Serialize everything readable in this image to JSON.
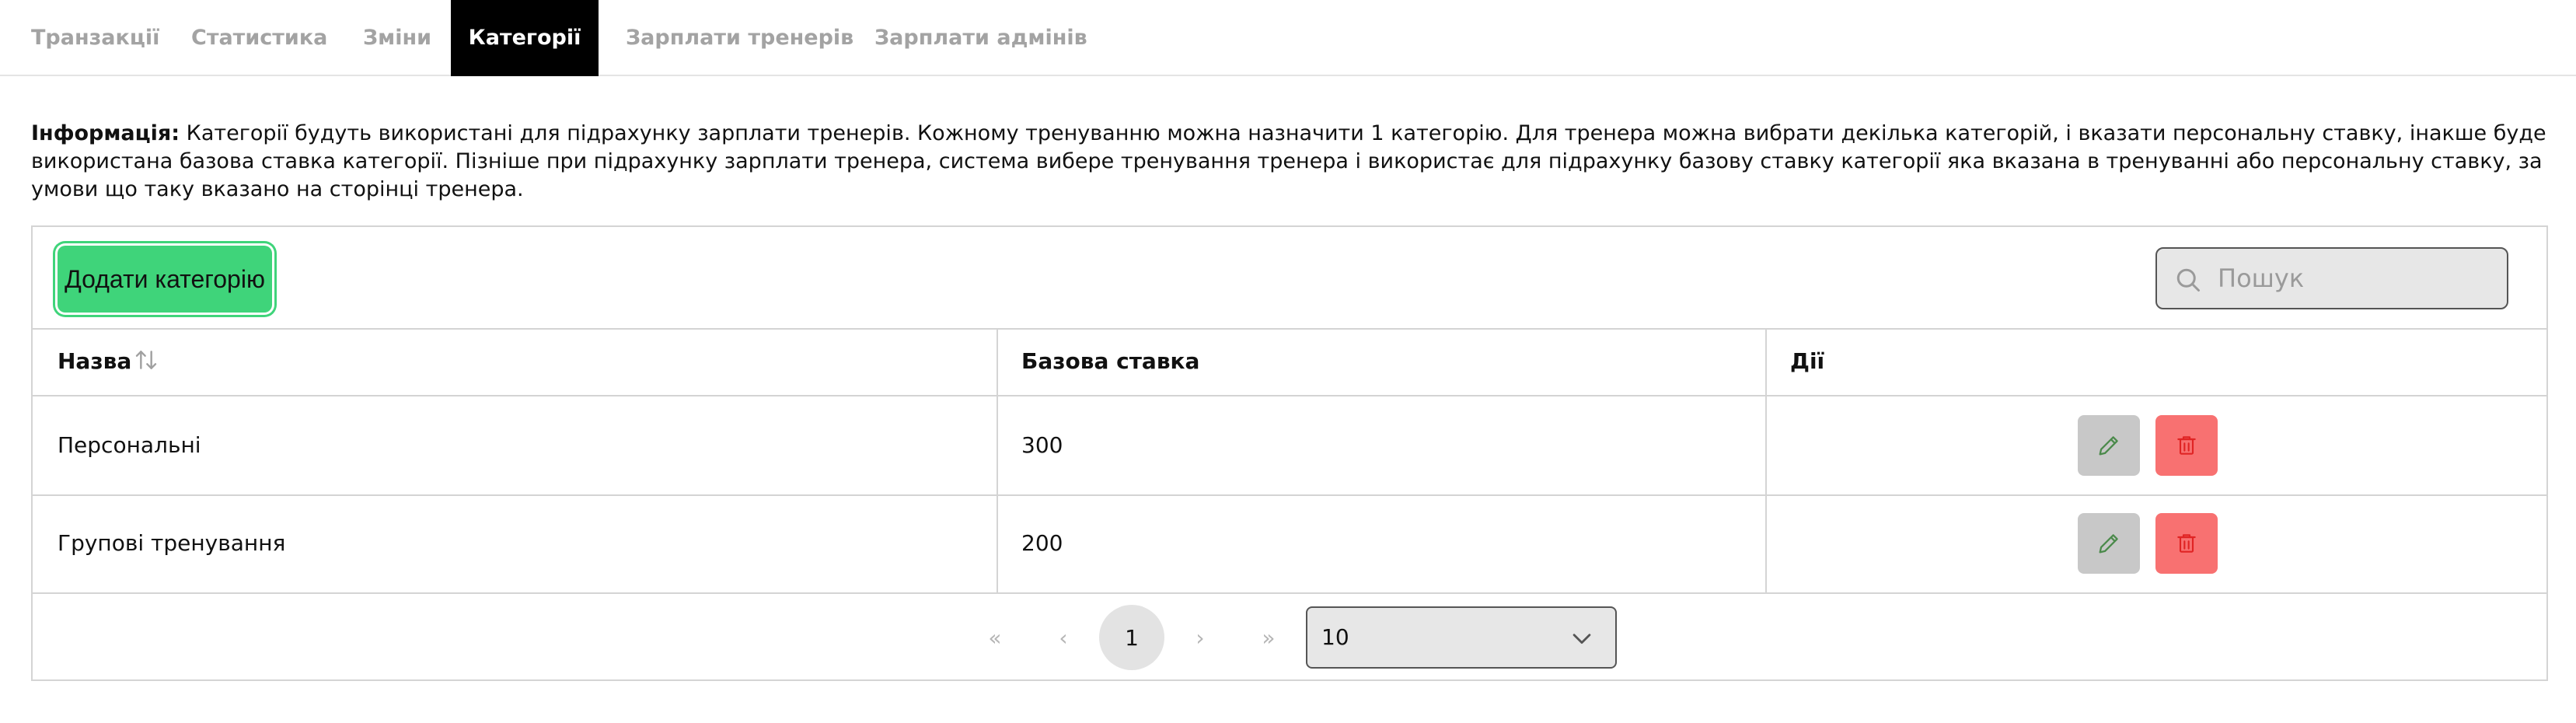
{
  "tabs": [
    {
      "label": "Транзакції",
      "active": false
    },
    {
      "label": "Статистика",
      "active": false
    },
    {
      "label": "Зміни",
      "active": false
    },
    {
      "label": "Категорії",
      "active": true
    },
    {
      "label": "Зарплати тренерів",
      "active": false
    },
    {
      "label": "Зарплати адмінів",
      "active": false
    }
  ],
  "info": {
    "label": "Інформація:",
    "text": "Категорії будуть використані для підрахунку зарплати тренерів. Кожному тренуванню можна назначити 1 категорію. Для тренера можна вибрати декілька категорій, і вказати персональну ставку, інакше буде використана базова ставка категорії. Пізніше при підрахунку зарплати тренера, система вибере тренування тренера і використає для підрахунку базову ставку категорії яка вказана в тренуванні або персональну ставку, за умови що таку вказано на сторінці тренера."
  },
  "toolbar": {
    "add_label": "Додати категорію",
    "search_placeholder": "Пошук",
    "search_value": ""
  },
  "table": {
    "headers": {
      "name": "Назва",
      "rate": "Базова ставка",
      "actions": "Дії"
    },
    "rows": [
      {
        "name": "Персональні",
        "rate": "300"
      },
      {
        "name": "Групові тренування",
        "rate": "200"
      }
    ]
  },
  "pagination": {
    "first": "«",
    "prev": "‹",
    "current": "1",
    "next": "›",
    "last": "»",
    "page_size": "10"
  },
  "colors": {
    "active_tab_bg": "#000000",
    "add_button": "#3fd47a",
    "edit_button": "#c8c8c8",
    "delete_button": "#f87171",
    "edit_icon": "#4b8a4b",
    "delete_icon": "#e02424"
  },
  "icons": {
    "search": "search-icon",
    "sort": "sort-icon",
    "edit": "pencil-icon",
    "delete": "trash-icon",
    "select": "chevron-down-icon"
  }
}
